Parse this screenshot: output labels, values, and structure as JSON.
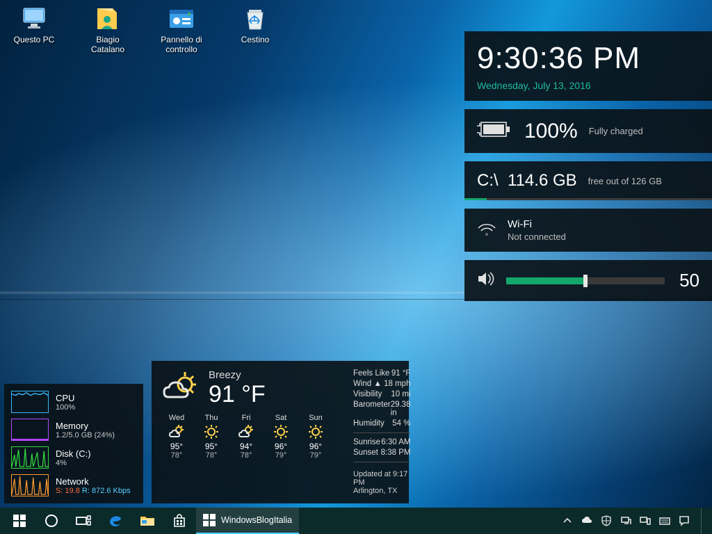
{
  "desktop_icons": [
    {
      "label": "Questo PC",
      "type": "pc"
    },
    {
      "label": "Biagio Catalano",
      "type": "user"
    },
    {
      "label": "Pannello di controllo",
      "type": "control-panel"
    },
    {
      "label": "Cestino",
      "type": "recycle"
    }
  ],
  "clock": {
    "time": "9:30:36 PM",
    "date": "Wednesday, July 13, 2016"
  },
  "battery": {
    "percent": "100%",
    "status": "Fully charged"
  },
  "drive": {
    "letter": "C:\\",
    "free": "114.6 GB",
    "total_label": "free out of 126 GB",
    "used_fraction": 0.09
  },
  "wifi": {
    "name": "Wi-Fi",
    "status": "Not connected"
  },
  "volume": {
    "value": "50",
    "fraction": 0.5
  },
  "sysmon": {
    "cpu": {
      "title": "CPU",
      "sub": "100%",
      "color": "#39b8ff"
    },
    "memory": {
      "title": "Memory",
      "sub": "1.2/5.0 GB (24%)",
      "color": "#b648ff"
    },
    "disk": {
      "title": "Disk (C:)",
      "sub": "4%",
      "color": "#33d93f"
    },
    "network": {
      "title": "Network",
      "send": "S: 19.8",
      "recv": "R: 872.6 Kbps",
      "color": "#ff9a2e"
    }
  },
  "weather": {
    "condition": "Breezy",
    "temp": "91 °F",
    "details": {
      "feels_like": "91 °F",
      "wind": "18 mph",
      "visibility": "10 mi",
      "barometer": "29.38 in",
      "humidity": "54 %",
      "sunrise": "6:30 AM",
      "sunset": "8:38 PM"
    },
    "labels": {
      "feels_like": "Feels Like",
      "wind": "Wind",
      "visibility": "Visibility",
      "barometer": "Barometer",
      "humidity": "Humidity",
      "sunrise": "Sunrise",
      "sunset": "Sunset",
      "updated_prefix": "Updated at"
    },
    "updated": "9:17 PM",
    "location": "Arlington, TX",
    "forecast": [
      {
        "day": "Wed",
        "hi": "95°",
        "lo": "78°",
        "icon": "partly"
      },
      {
        "day": "Thu",
        "hi": "95°",
        "lo": "78°",
        "icon": "sunny"
      },
      {
        "day": "Fri",
        "hi": "94°",
        "lo": "78°",
        "icon": "partly"
      },
      {
        "day": "Sat",
        "hi": "96°",
        "lo": "79°",
        "icon": "sunny"
      },
      {
        "day": "Sun",
        "hi": "96°",
        "lo": "79°",
        "icon": "sunny"
      }
    ]
  },
  "taskbar": {
    "running_app": "WindowsBlogItalia"
  }
}
